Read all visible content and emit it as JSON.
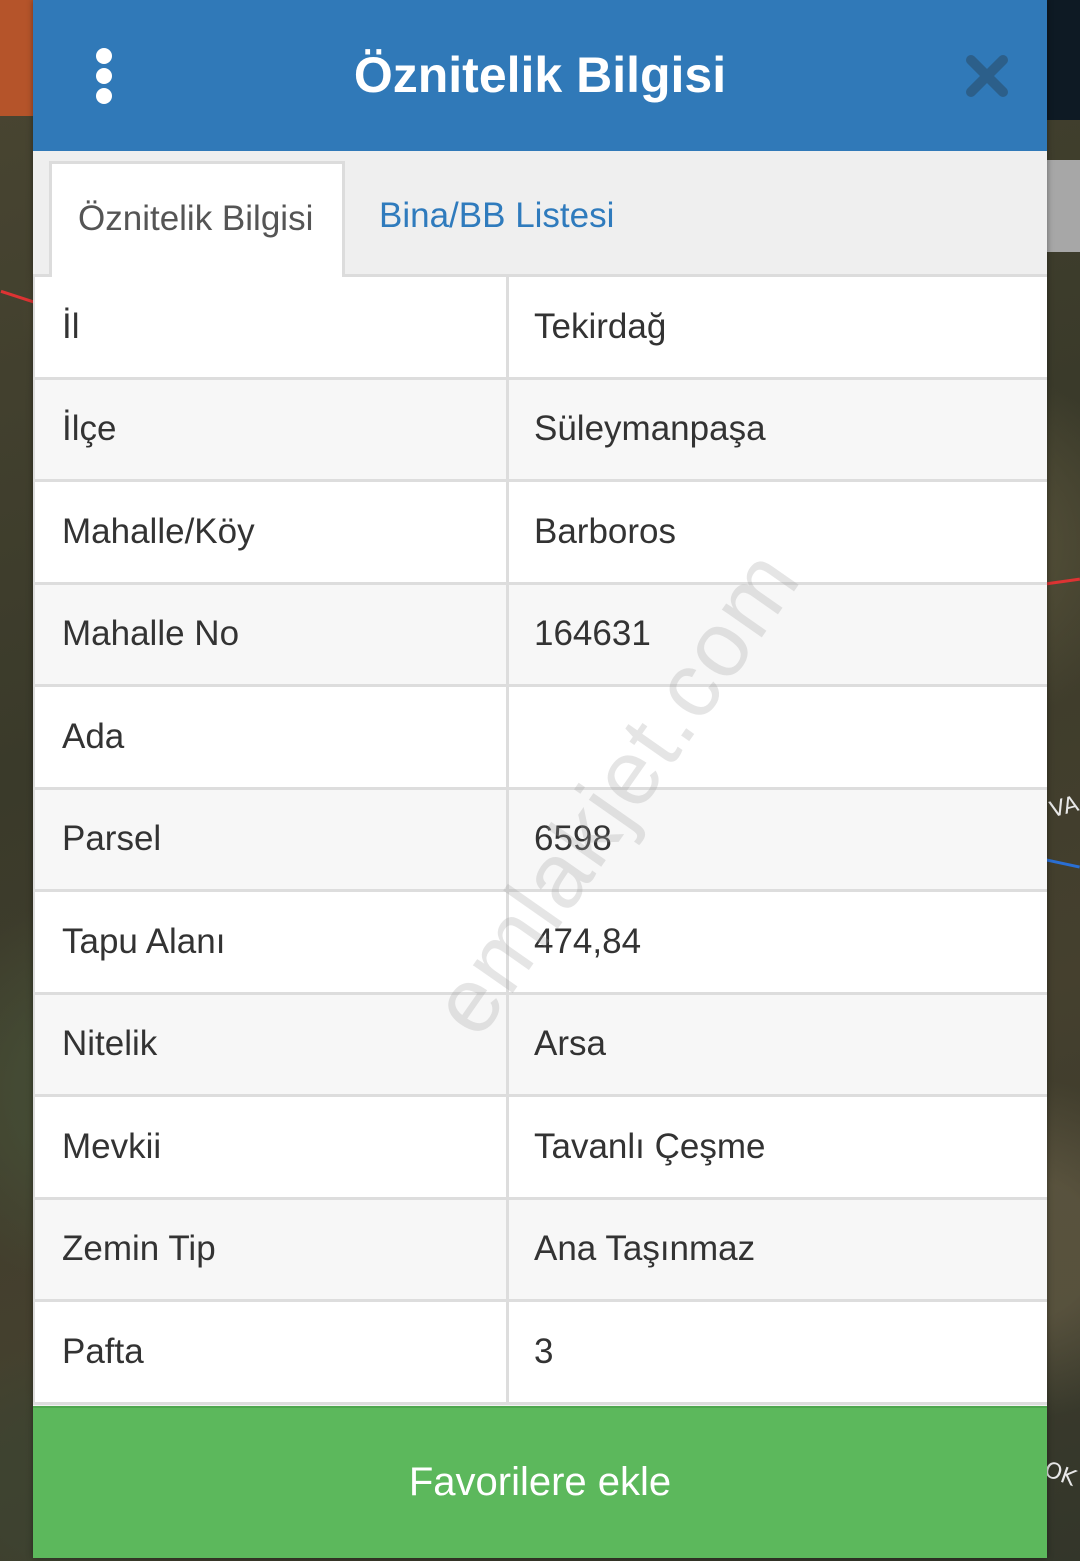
{
  "dialog": {
    "title": "Öznitelik Bilgisi",
    "menu_icon": "more-vertical-icon",
    "close_icon": "close-icon"
  },
  "tabs": [
    {
      "label": "Öznitelik Bilgisi",
      "active": true
    },
    {
      "label": "Bina/BB Listesi",
      "active": false
    }
  ],
  "attributes": [
    {
      "key": "İl",
      "value": "Tekirdağ"
    },
    {
      "key": "İlçe",
      "value": "Süleymanpaşa"
    },
    {
      "key": "Mahalle/Köy",
      "value": "Barboros"
    },
    {
      "key": "Mahalle No",
      "value": "164631"
    },
    {
      "key": "Ada",
      "value": ""
    },
    {
      "key": "Parsel",
      "value": "6598"
    },
    {
      "key": "Tapu Alanı",
      "value": "474,84"
    },
    {
      "key": "Nitelik",
      "value": "Arsa"
    },
    {
      "key": "Mevkii",
      "value": "Tavanlı Çeşme"
    },
    {
      "key": "Zemin Tip",
      "value": "Ana Taşınmaz"
    },
    {
      "key": "Pafta",
      "value": "3"
    }
  ],
  "watermark": "emlakjet.com",
  "map_labels": {
    "right_mid": "VA",
    "right_bottom": "OK"
  },
  "actions": {
    "favorite_label": "Favorilere ekle"
  },
  "colors": {
    "header": "#3079b8",
    "tab_inactive_text": "#2f7bbd",
    "favorite_button": "#5cb85c",
    "close_icon": "#2c5f8a"
  }
}
